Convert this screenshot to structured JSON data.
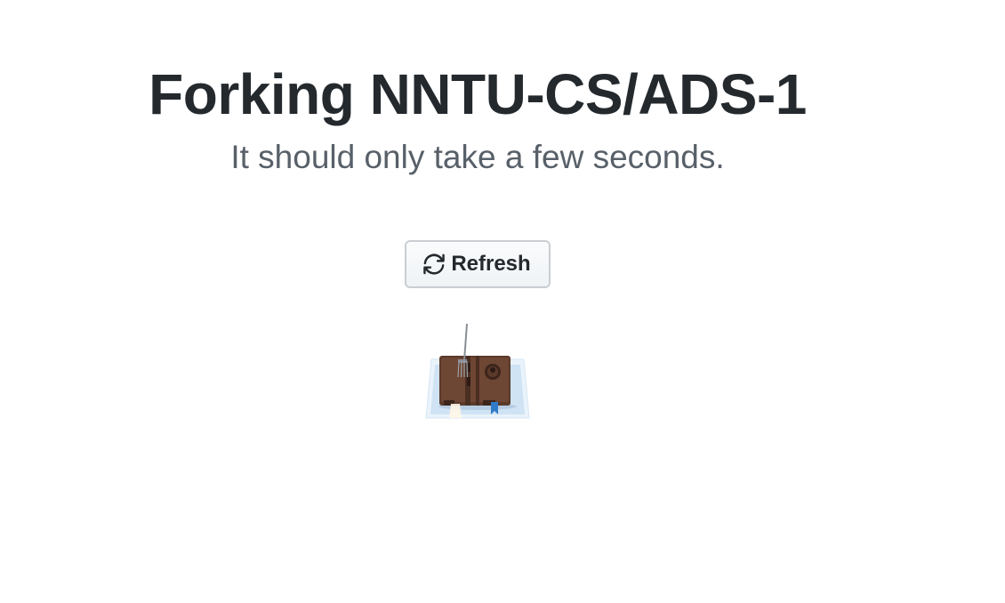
{
  "heading": {
    "title": "Forking NNTU-CS/ADS-1",
    "subtitle": "It should only take a few seconds."
  },
  "actions": {
    "refresh_label": "Refresh",
    "refresh_icon": "sync-icon"
  },
  "illustration": {
    "icon": "fork-in-book-illustration"
  }
}
